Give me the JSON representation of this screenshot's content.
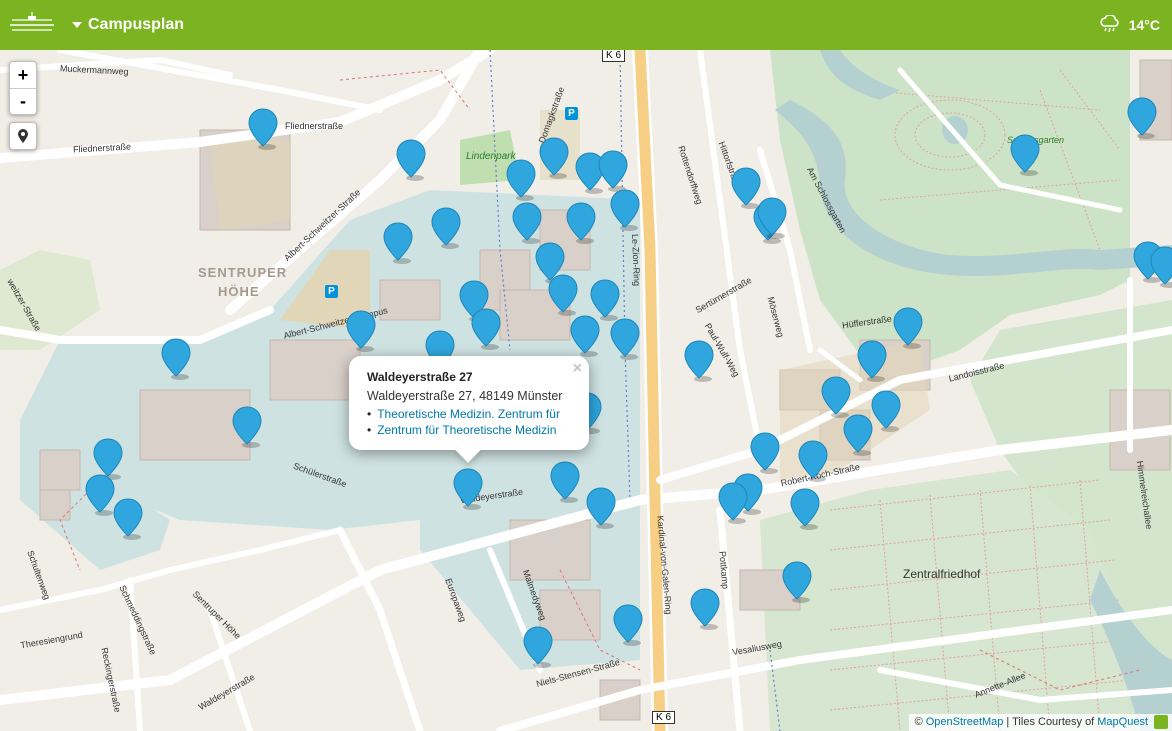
{
  "header": {
    "title": "Campusplan",
    "weather_temp": "14°C",
    "menu_icon": "university-logo-icon",
    "weather_icon": "rain-cloud-icon",
    "accent_color": "#7cb321"
  },
  "controls": {
    "zoom_in": "+",
    "zoom_out": "-",
    "locate_icon": "location-pin-icon"
  },
  "popup": {
    "title": "Waldeyerstraße 27",
    "address": "Waldeyerstraße 27, 48149 Münster",
    "links": [
      "Theoretische Medizin. Zentrum für",
      "Zentrum für Theoretische Medizin"
    ],
    "close": "×"
  },
  "attribution": {
    "prefix": "©",
    "osm": "OpenStreetMap",
    "middle": "| Tiles Courtesy of",
    "mapquest": "MapQuest"
  },
  "map_labels": {
    "muckermannweg": "Muckermannweg",
    "fliednerstrasse_a": "Fliednerstraße",
    "fliednerstrasse_b": "Fliednerstraße",
    "albert_schweitzer_strasse": "Albert-Schweitzer-Straße",
    "sentruper": "SENTRUPER",
    "hoehe": "HÖHE",
    "albert_schweitzer_campus": "Albert-Schweitzer-Campus",
    "domagkstrasse": "Domagkstraße",
    "lindenpark": "Lindenpark",
    "le_zion_ring": "Le-Zion-Ring",
    "k6_top": "K 6",
    "k6_bottom": "K 6",
    "rottendorffweg": "Rottendorffweg",
    "hittorfstrasse": "Hittorfstraße",
    "am_schlossgarten": "Am Schlossgarten",
    "schlossgarten": "Schlossgarten",
    "sertuernerstrasse": "Sertürnerstraße",
    "paul_wulf_weg": "Paul-Wulf-Weg",
    "moeserweg": "Möserweg",
    "huefferstrasse": "Hüfferstraße",
    "landoisstrasse": "Landoisstraße",
    "robert_koch_strasse": "Robert-Koch-Straße",
    "himmelreichallee": "Himmelreichallee",
    "zentralfriedhof": "Zentralfriedhof",
    "waldeyerstrasse_a": "Waldeyerstraße",
    "waldeyerstrasse_b": "Waldeyerstraße",
    "schuelerstrasse": "Schülerstraße",
    "kardinal_von_galen_ring": "Kardinal-von-Galen-Ring",
    "pottkamp": "Pottkamp",
    "vesaliusweg": "Vesaliusweg",
    "niels_stensen_strasse": "Niels-Stensen-Straße",
    "europaweg": "Europaweg",
    "malmedyweg": "Malmedyweg",
    "schultenweg": "Schultenweg",
    "schmeddingstrasse": "Schmeddingstraße",
    "theresiengrund": "Theresiengrund",
    "reckingerstrasse": "Reckingerstraße",
    "sentruper_hoehe": "Sentruper Höhe",
    "annette_allee": "Annette-Allee",
    "schweitzer_strasse_left": "weitzer-Straße"
  },
  "marker_color": "#2fa6de",
  "marker_icon": "map-marker-icon"
}
